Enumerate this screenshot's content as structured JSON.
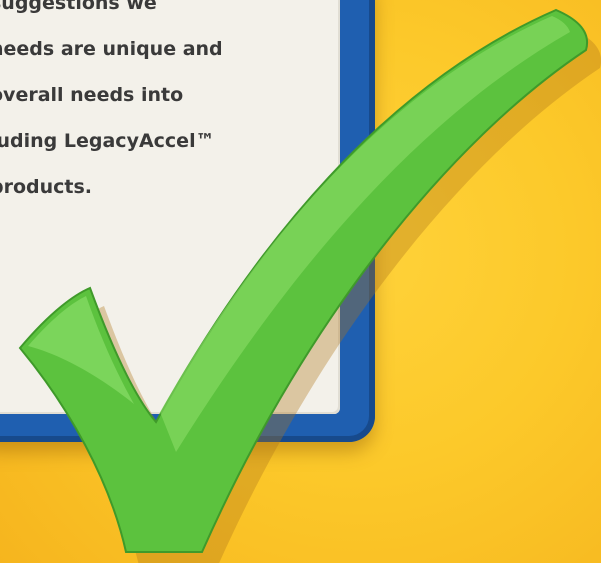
{
  "paper": {
    "lines": [
      "suggestions we",
      "needs are unique and",
      "overall needs into",
      "luding LegacyAccel™",
      "products."
    ]
  },
  "colors": {
    "background": "#fcc92a",
    "clipboard": "#1f5fb0",
    "paper": "#f3f1ea",
    "check": "#5cc23e",
    "text": "#3a3a3a"
  },
  "icons": {
    "check": "checkmark-icon"
  }
}
